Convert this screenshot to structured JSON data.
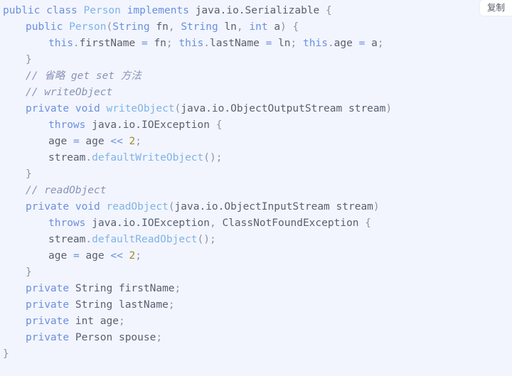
{
  "toolbar": {
    "copy_label": "复制"
  },
  "editor": {
    "language": "java",
    "background_color": "#f2f5fd",
    "colors": {
      "keyword": "#6a8fe0",
      "type": "#7fb3e8",
      "plain": "#5a6070",
      "punctuation": "#8d93a6",
      "number": "#a08a2a",
      "comment": "#8a93b8"
    },
    "lines": [
      {
        "indent": 0,
        "tokens": [
          {
            "t": "public",
            "c": "kw"
          },
          {
            "t": " ",
            "c": "plain"
          },
          {
            "t": "class",
            "c": "kw"
          },
          {
            "t": " ",
            "c": "plain"
          },
          {
            "t": "Person",
            "c": "type"
          },
          {
            "t": " ",
            "c": "plain"
          },
          {
            "t": "implements",
            "c": "kw"
          },
          {
            "t": " ",
            "c": "plain"
          },
          {
            "t": "java.io.Serializable",
            "c": "plain"
          },
          {
            "t": " ",
            "c": "plain"
          },
          {
            "t": "{",
            "c": "punct"
          }
        ]
      },
      {
        "indent": 1,
        "tokens": [
          {
            "t": "public",
            "c": "kw"
          },
          {
            "t": " ",
            "c": "plain"
          },
          {
            "t": "Person",
            "c": "type"
          },
          {
            "t": "(",
            "c": "punct"
          },
          {
            "t": "String",
            "c": "kw"
          },
          {
            "t": " ",
            "c": "plain"
          },
          {
            "t": "fn",
            "c": "plain"
          },
          {
            "t": ", ",
            "c": "punct"
          },
          {
            "t": "String",
            "c": "kw"
          },
          {
            "t": " ",
            "c": "plain"
          },
          {
            "t": "ln",
            "c": "plain"
          },
          {
            "t": ", ",
            "c": "punct"
          },
          {
            "t": "int",
            "c": "kw"
          },
          {
            "t": " ",
            "c": "plain"
          },
          {
            "t": "a",
            "c": "plain"
          },
          {
            "t": ") ",
            "c": "punct"
          },
          {
            "t": "{",
            "c": "punct"
          }
        ]
      },
      {
        "indent": 2,
        "tokens": [
          {
            "t": "this",
            "c": "kw"
          },
          {
            "t": ".",
            "c": "punct"
          },
          {
            "t": "firstName",
            "c": "plain"
          },
          {
            "t": " ",
            "c": "plain"
          },
          {
            "t": "=",
            "c": "op"
          },
          {
            "t": " ",
            "c": "plain"
          },
          {
            "t": "fn",
            "c": "plain"
          },
          {
            "t": "; ",
            "c": "punct"
          },
          {
            "t": "this",
            "c": "kw"
          },
          {
            "t": ".",
            "c": "punct"
          },
          {
            "t": "lastName",
            "c": "plain"
          },
          {
            "t": " ",
            "c": "plain"
          },
          {
            "t": "=",
            "c": "op"
          },
          {
            "t": " ",
            "c": "plain"
          },
          {
            "t": "ln",
            "c": "plain"
          },
          {
            "t": "; ",
            "c": "punct"
          },
          {
            "t": "this",
            "c": "kw"
          },
          {
            "t": ".",
            "c": "punct"
          },
          {
            "t": "age",
            "c": "plain"
          },
          {
            "t": " ",
            "c": "plain"
          },
          {
            "t": "=",
            "c": "op"
          },
          {
            "t": " ",
            "c": "plain"
          },
          {
            "t": "a",
            "c": "plain"
          },
          {
            "t": ";",
            "c": "punct"
          }
        ]
      },
      {
        "indent": 1,
        "tokens": [
          {
            "t": "}",
            "c": "punct"
          }
        ]
      },
      {
        "indent": 1,
        "tokens": [
          {
            "t": "// 省略 get set 方法",
            "c": "comment"
          }
        ]
      },
      {
        "indent": 1,
        "tokens": [
          {
            "t": "// writeObject",
            "c": "comment"
          }
        ]
      },
      {
        "indent": 1,
        "tokens": [
          {
            "t": "private",
            "c": "kw"
          },
          {
            "t": " ",
            "c": "plain"
          },
          {
            "t": "void",
            "c": "kw"
          },
          {
            "t": " ",
            "c": "plain"
          },
          {
            "t": "writeObject",
            "c": "type"
          },
          {
            "t": "(",
            "c": "punct"
          },
          {
            "t": "java.io.ObjectOutputStream",
            "c": "plain"
          },
          {
            "t": " ",
            "c": "plain"
          },
          {
            "t": "stream",
            "c": "plain"
          },
          {
            "t": ")",
            "c": "punct"
          }
        ]
      },
      {
        "indent": 2,
        "tokens": [
          {
            "t": "throws",
            "c": "kw"
          },
          {
            "t": " ",
            "c": "plain"
          },
          {
            "t": "java.io.IOException",
            "c": "plain"
          },
          {
            "t": " ",
            "c": "plain"
          },
          {
            "t": "{",
            "c": "punct"
          }
        ]
      },
      {
        "indent": 2,
        "tokens": [
          {
            "t": "age",
            "c": "plain"
          },
          {
            "t": " ",
            "c": "plain"
          },
          {
            "t": "=",
            "c": "op"
          },
          {
            "t": " ",
            "c": "plain"
          },
          {
            "t": "age",
            "c": "plain"
          },
          {
            "t": " ",
            "c": "plain"
          },
          {
            "t": "<<",
            "c": "op"
          },
          {
            "t": " ",
            "c": "plain"
          },
          {
            "t": "2",
            "c": "num"
          },
          {
            "t": ";",
            "c": "punct"
          }
        ]
      },
      {
        "indent": 2,
        "tokens": [
          {
            "t": "stream",
            "c": "plain"
          },
          {
            "t": ".",
            "c": "punct"
          },
          {
            "t": "defaultWriteObject",
            "c": "type"
          },
          {
            "t": "();",
            "c": "punct"
          }
        ]
      },
      {
        "indent": 1,
        "tokens": [
          {
            "t": "}",
            "c": "punct"
          }
        ]
      },
      {
        "indent": 1,
        "tokens": [
          {
            "t": "// readObject",
            "c": "comment"
          }
        ]
      },
      {
        "indent": 1,
        "tokens": [
          {
            "t": "private",
            "c": "kw"
          },
          {
            "t": " ",
            "c": "plain"
          },
          {
            "t": "void",
            "c": "kw"
          },
          {
            "t": " ",
            "c": "plain"
          },
          {
            "t": "readObject",
            "c": "type"
          },
          {
            "t": "(",
            "c": "punct"
          },
          {
            "t": "java.io.ObjectInputStream",
            "c": "plain"
          },
          {
            "t": " ",
            "c": "plain"
          },
          {
            "t": "stream",
            "c": "plain"
          },
          {
            "t": ")",
            "c": "punct"
          }
        ]
      },
      {
        "indent": 2,
        "tokens": [
          {
            "t": "throws",
            "c": "kw"
          },
          {
            "t": " ",
            "c": "plain"
          },
          {
            "t": "java.io.IOException",
            "c": "plain"
          },
          {
            "t": ", ",
            "c": "punct"
          },
          {
            "t": "ClassNotFoundException",
            "c": "plain"
          },
          {
            "t": " ",
            "c": "plain"
          },
          {
            "t": "{",
            "c": "punct"
          }
        ]
      },
      {
        "indent": 2,
        "tokens": [
          {
            "t": "stream",
            "c": "plain"
          },
          {
            "t": ".",
            "c": "punct"
          },
          {
            "t": "defaultReadObject",
            "c": "type"
          },
          {
            "t": "();",
            "c": "punct"
          }
        ]
      },
      {
        "indent": 2,
        "tokens": [
          {
            "t": "age",
            "c": "plain"
          },
          {
            "t": " ",
            "c": "plain"
          },
          {
            "t": "=",
            "c": "op"
          },
          {
            "t": " ",
            "c": "plain"
          },
          {
            "t": "age",
            "c": "plain"
          },
          {
            "t": " ",
            "c": "plain"
          },
          {
            "t": "<<",
            "c": "op"
          },
          {
            "t": " ",
            "c": "plain"
          },
          {
            "t": "2",
            "c": "num"
          },
          {
            "t": ";",
            "c": "punct"
          }
        ]
      },
      {
        "indent": 1,
        "tokens": [
          {
            "t": "}",
            "c": "punct"
          }
        ]
      },
      {
        "indent": 1,
        "tokens": [
          {
            "t": "private",
            "c": "kw"
          },
          {
            "t": " ",
            "c": "plain"
          },
          {
            "t": "String",
            "c": "plain"
          },
          {
            "t": " ",
            "c": "plain"
          },
          {
            "t": "firstName",
            "c": "plain"
          },
          {
            "t": ";",
            "c": "punct"
          }
        ]
      },
      {
        "indent": 1,
        "tokens": [
          {
            "t": "private",
            "c": "kw"
          },
          {
            "t": " ",
            "c": "plain"
          },
          {
            "t": "String",
            "c": "plain"
          },
          {
            "t": " ",
            "c": "plain"
          },
          {
            "t": "lastName",
            "c": "plain"
          },
          {
            "t": ";",
            "c": "punct"
          }
        ]
      },
      {
        "indent": 1,
        "tokens": [
          {
            "t": "private",
            "c": "kw"
          },
          {
            "t": " ",
            "c": "plain"
          },
          {
            "t": "int",
            "c": "plain"
          },
          {
            "t": " ",
            "c": "plain"
          },
          {
            "t": "age",
            "c": "plain"
          },
          {
            "t": ";",
            "c": "punct"
          }
        ]
      },
      {
        "indent": 1,
        "tokens": [
          {
            "t": "private",
            "c": "kw"
          },
          {
            "t": " ",
            "c": "plain"
          },
          {
            "t": "Person",
            "c": "plain"
          },
          {
            "t": " ",
            "c": "plain"
          },
          {
            "t": "spouse",
            "c": "plain"
          },
          {
            "t": ";",
            "c": "punct"
          }
        ]
      },
      {
        "indent": 0,
        "tokens": [
          {
            "t": "}",
            "c": "punct"
          }
        ]
      }
    ]
  }
}
